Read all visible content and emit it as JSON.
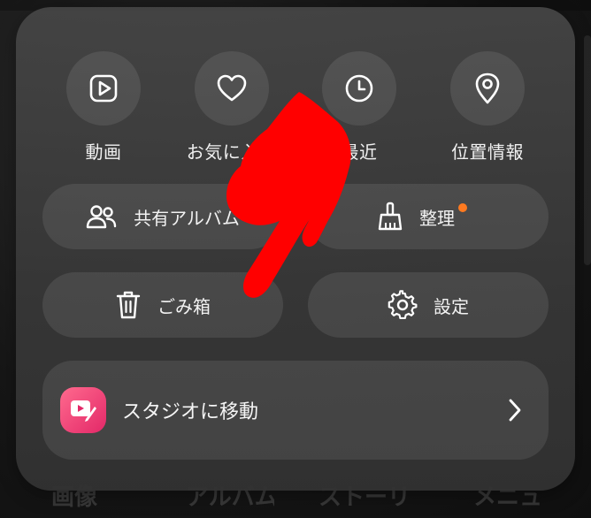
{
  "background": {
    "bottom_tabs": [
      "画像",
      "アルバム",
      "ストーリー",
      "メニュー"
    ]
  },
  "quick_actions": [
    {
      "label": "動画",
      "icon": "play-square-icon"
    },
    {
      "label": "お気に入り",
      "icon": "heart-icon"
    },
    {
      "label": "最近",
      "icon": "clock-icon"
    },
    {
      "label": "位置情報",
      "icon": "location-pin-icon"
    }
  ],
  "actions": {
    "shared_album": {
      "label": "共有アルバム",
      "icon": "people-icon"
    },
    "cleanup": {
      "label": "整理",
      "icon": "broom-icon",
      "badge_color": "#ff7a20"
    },
    "trash": {
      "label": "ごみ箱",
      "icon": "trash-icon"
    },
    "settings": {
      "label": "設定",
      "icon": "gear-icon"
    }
  },
  "studio": {
    "label": "スタジオに移動",
    "icon": "studio-app-icon",
    "accent": "#e83b6f"
  },
  "overlay": {
    "pointer_icon": "red-pointing-hand-icon",
    "color": "#ff0000"
  }
}
